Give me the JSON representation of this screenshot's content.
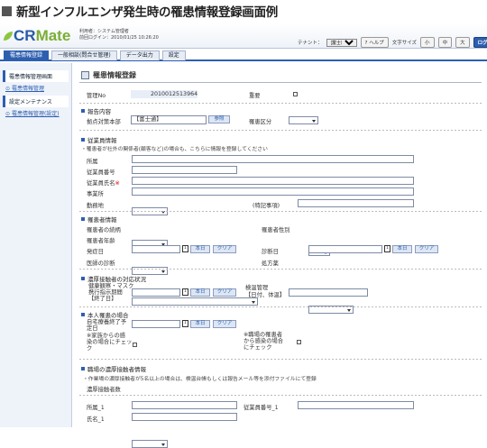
{
  "caption": "新型インフルエンザ発生時の罹患情報登録画面例",
  "app": {
    "logo_cr": "CR",
    "logo_mate": "Mate",
    "user_line1": "利用者：システム管理者",
    "user_line2": "前回ログイン：2010/01/25 10:26:20",
    "tenant_label": "テナント：",
    "tenant_value": "[富士通]",
    "help": "ヘルプ",
    "font_size": "文字サイズ",
    "size_small": "小",
    "size_mid": "中",
    "size_large": "大",
    "logout": "ログアウト"
  },
  "nav": {
    "tabs": [
      "罹患情報登録",
      "一般相談(問合せ管理)",
      "データ出力",
      "設定"
    ]
  },
  "sidebar": {
    "section1": "罹患情報管理画面",
    "link1": "罹患情報管理",
    "section2": "設定メンテナンス",
    "link2": "罹患情報管理(設定)"
  },
  "page": {
    "title": "罹患情報登録"
  },
  "form": {
    "mgmt_no_label": "管理No",
    "mgmt_no": "2010012513964",
    "important_label": "重要",
    "report_section": "報告内容",
    "base_label": "拠点対策本部",
    "base_value": "【富士通】",
    "ref_btn": "参照",
    "class_label": "罹患区分",
    "emp_section": "従業員情報",
    "emp_note": "・罹患者が社外の関係者(顧客など)の場合も、こちらに情報を登録してください",
    "dept": "所属",
    "emp_no": "従業員番号",
    "emp_name": "従業員氏名",
    "office": "事業所",
    "work": "勤務地",
    "special": "(特記事項)",
    "patient_section": "罹患者情報",
    "relation": "罹患者の続柄",
    "sex": "罹患者性別",
    "age": "罹患者年齢",
    "onset": "発症日",
    "diagnosis_date": "診断日",
    "doctor": "医師の診断",
    "prescription": "処方薬",
    "today": "本日",
    "clear": "クリア",
    "contact_section": "濃厚接触者の対応状況",
    "mask1": "健康観察・マスク",
    "mask2": "携行指示期間",
    "mask3": "【終了日】",
    "health1": "検温管理",
    "health2": "【日付、体温】",
    "self_section": "本人罹患の場合",
    "home1": "自宅療養終了予",
    "home2": "定日",
    "fam1": "※家族からの感",
    "fam2": "染の場合にチェッ",
    "fam3": "ク",
    "sick1": "※職場の罹患者",
    "sick2": "から感染の場合",
    "sick3": "にチェック",
    "workplace_section": "職場の濃厚接触者情報",
    "workplace_note": "・作業場の濃厚接触者が5名以上の場合は、検温台帳もしくは報告メール等を添付ファイルにて登録",
    "contact_count": "濃厚接触者数",
    "dept1": "所属_1",
    "empno1": "従業員番号_1",
    "name1": "氏名_1"
  }
}
